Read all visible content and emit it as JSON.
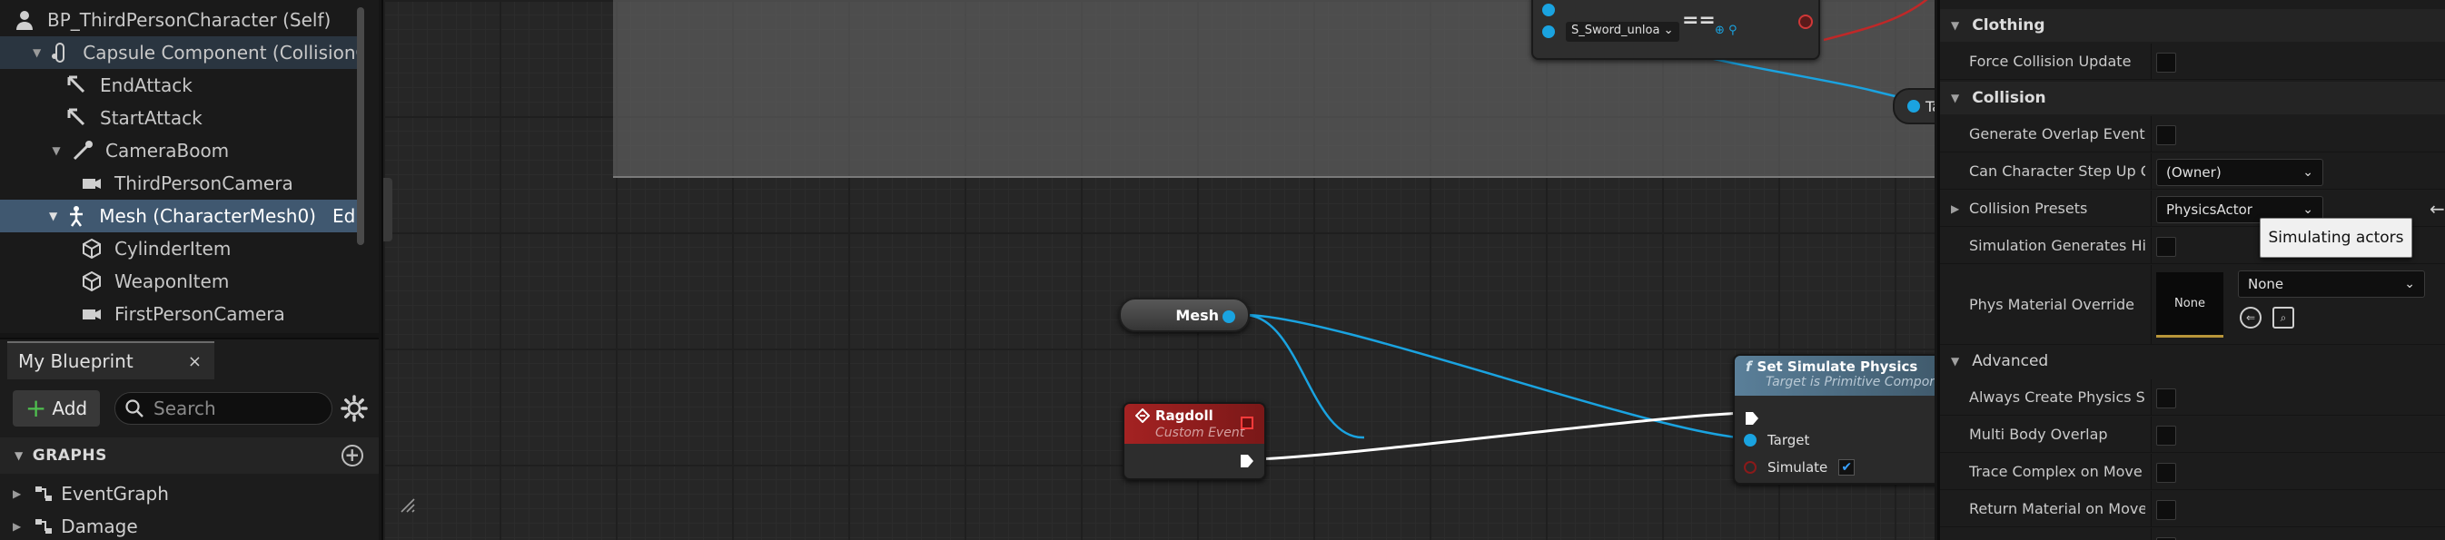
{
  "components": {
    "items": [
      {
        "label": "BP_ThirdPersonCharacter (Self)",
        "icon": "character-icon"
      },
      {
        "label": "Capsule Component (CollisionCyl",
        "icon": "capsule-icon"
      },
      {
        "label": "EndAttack",
        "icon": "arrow-component-icon"
      },
      {
        "label": "StartAttack",
        "icon": "arrow-component-icon"
      },
      {
        "label": "CameraBoom",
        "icon": "spring-arm-icon"
      },
      {
        "label": "ThirdPersonCamera",
        "icon": "camera-icon"
      },
      {
        "label": "Mesh (CharacterMesh0)",
        "icon": "skeletal-mesh-icon",
        "suffix": "Edit in"
      },
      {
        "label": "CylinderItem",
        "icon": "static-mesh-icon"
      },
      {
        "label": "WeaponItem",
        "icon": "static-mesh-icon"
      },
      {
        "label": "FirstPersonCamera",
        "icon": "camera-icon"
      }
    ]
  },
  "my_blueprint": {
    "tab_label": "My Blueprint",
    "close_glyph": "×",
    "add_label": "Add",
    "search_placeholder": "Search",
    "graphs_label": "GRAPHS",
    "graphs": [
      {
        "label": "EventGraph",
        "icon": "graph-icon"
      },
      {
        "label": "Damage",
        "icon": "graph-icon"
      }
    ]
  },
  "graph": {
    "partial_node": {
      "combo": "S_Sword_unloa",
      "operator": "=="
    },
    "partial_right_node": {
      "label": "Ta"
    },
    "mesh_node": {
      "label": "Mesh"
    },
    "ragdoll_node": {
      "title": "Ragdoll",
      "subtitle": "Custom Event"
    },
    "set_simulate_node": {
      "title": "Set Simulate Physics",
      "subtitle": "Target is Primitive Component",
      "fx": "f",
      "pin_target": "Target",
      "pin_simulate": "Simulate",
      "simulate_checked": true
    },
    "colors": {
      "exec_wire": "#ffffff",
      "object_wire": "#1aa3e0",
      "event_header": "#a42222",
      "function_header": "#5a7f99"
    }
  },
  "details": {
    "sections": {
      "clothing": "Clothing",
      "collision": "Collision",
      "advanced": "Advanced"
    },
    "props": {
      "force_collision_update": "Force Collision Update",
      "generate_overlap_events": "Generate Overlap Events",
      "can_step_up": "Can Character Step Up On",
      "can_step_up_value": "(Owner)",
      "collision_presets": "Collision Presets",
      "collision_presets_value": "PhysicsActor",
      "simulation_generates_hit": "Simulation Generates Hi...",
      "phys_material_override": "Phys Material Override",
      "phys_material_thumb": "None",
      "phys_material_value": "None",
      "always_create_physics": "Always Create Physics S...",
      "multi_body_overlap": "Multi Body Overlap",
      "trace_complex": "Trace Complex on Move",
      "return_material": "Return Material on Move"
    },
    "tooltip": "Simulating actors",
    "reset_glyph": "←"
  }
}
